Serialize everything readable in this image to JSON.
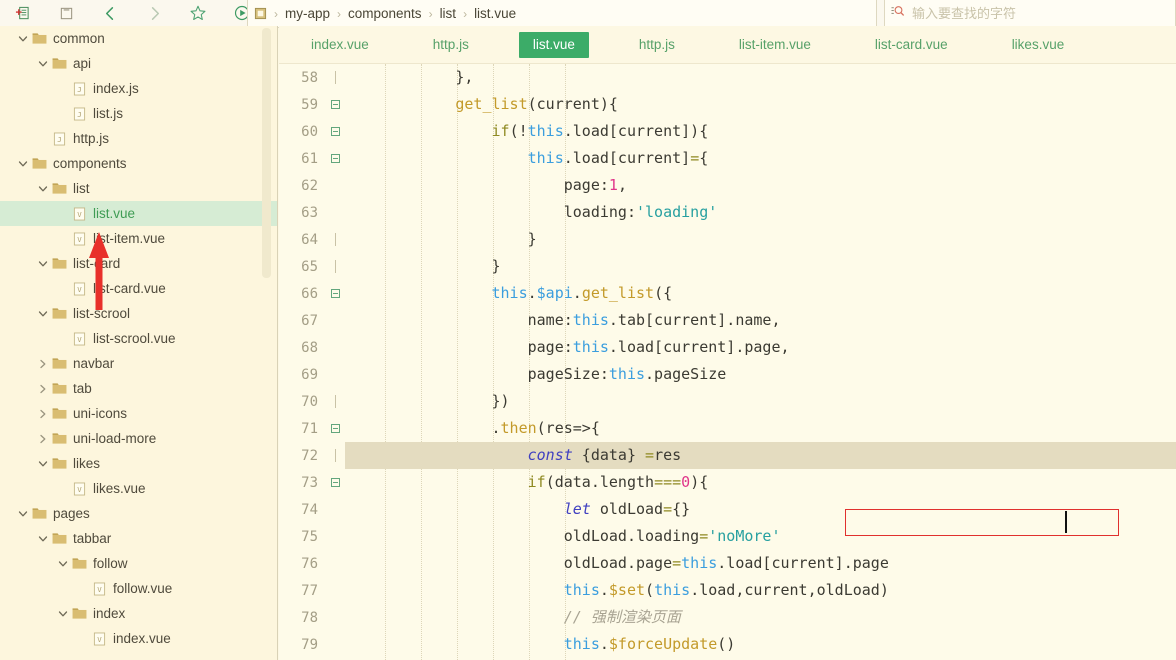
{
  "toolbar": {
    "icons": [
      {
        "name": "new-file-icon",
        "label": "New File"
      },
      {
        "name": "save-icon",
        "label": "Save"
      },
      {
        "name": "back-arrow-icon",
        "label": "Back"
      },
      {
        "name": "forward-arrow-icon",
        "label": "Forward"
      },
      {
        "name": "star-icon",
        "label": "Favorite"
      },
      {
        "name": "run-icon",
        "label": "Run"
      }
    ]
  },
  "breadcrumb": {
    "root_icon": "project-icon",
    "separator": "›",
    "items": [
      "my-app",
      "components",
      "list",
      "list.vue"
    ]
  },
  "search": {
    "icon": "search-icon",
    "placeholder": "输入要查找的字符",
    "value": ""
  },
  "sidebar": {
    "scrollbar": true,
    "tree": [
      {
        "label": "common",
        "type": "folder",
        "depth": 0,
        "state": "expanded",
        "selected": false
      },
      {
        "label": "api",
        "type": "folder",
        "depth": 1,
        "state": "expanded",
        "selected": false
      },
      {
        "label": "index.js",
        "type": "js",
        "depth": 2,
        "state": "leaf",
        "selected": false
      },
      {
        "label": "list.js",
        "type": "js",
        "depth": 2,
        "state": "leaf",
        "selected": false
      },
      {
        "label": "http.js",
        "type": "js",
        "depth": 1,
        "state": "leaf",
        "selected": false
      },
      {
        "label": "components",
        "type": "folder",
        "depth": 0,
        "state": "expanded",
        "selected": false
      },
      {
        "label": "list",
        "type": "folder",
        "depth": 1,
        "state": "expanded",
        "selected": false
      },
      {
        "label": "list.vue",
        "type": "vue",
        "depth": 2,
        "state": "leaf",
        "selected": true
      },
      {
        "label": "list-item.vue",
        "type": "vue",
        "depth": 2,
        "state": "leaf",
        "selected": false
      },
      {
        "label": "list-card",
        "type": "folder",
        "depth": 1,
        "state": "expanded",
        "selected": false
      },
      {
        "label": "list-card.vue",
        "type": "vue",
        "depth": 2,
        "state": "leaf",
        "selected": false
      },
      {
        "label": "list-scrool",
        "type": "folder",
        "depth": 1,
        "state": "expanded",
        "selected": false
      },
      {
        "label": "list-scrool.vue",
        "type": "vue",
        "depth": 2,
        "state": "leaf",
        "selected": false
      },
      {
        "label": "navbar",
        "type": "folder",
        "depth": 1,
        "state": "collapsed",
        "selected": false
      },
      {
        "label": "tab",
        "type": "folder",
        "depth": 1,
        "state": "collapsed",
        "selected": false
      },
      {
        "label": "uni-icons",
        "type": "folder",
        "depth": 1,
        "state": "collapsed",
        "selected": false
      },
      {
        "label": "uni-load-more",
        "type": "folder",
        "depth": 1,
        "state": "collapsed",
        "selected": false
      },
      {
        "label": "likes",
        "type": "folder",
        "depth": 1,
        "state": "expanded",
        "selected": false
      },
      {
        "label": "likes.vue",
        "type": "vue",
        "depth": 2,
        "state": "leaf",
        "selected": false
      },
      {
        "label": "pages",
        "type": "folder",
        "depth": 0,
        "state": "expanded",
        "selected": false
      },
      {
        "label": "tabbar",
        "type": "folder",
        "depth": 1,
        "state": "expanded",
        "selected": false
      },
      {
        "label": "follow",
        "type": "folder",
        "depth": 2,
        "state": "expanded",
        "selected": false
      },
      {
        "label": "follow.vue",
        "type": "vue",
        "depth": 3,
        "state": "leaf",
        "selected": false
      },
      {
        "label": "index",
        "type": "folder",
        "depth": 2,
        "state": "expanded",
        "selected": false
      },
      {
        "label": "index.vue",
        "type": "vue",
        "depth": 3,
        "state": "leaf",
        "selected": false
      }
    ]
  },
  "annotation": {
    "arrow_color": "#e8302a",
    "points_at": "list.vue"
  },
  "editor": {
    "tabs": [
      {
        "label": "index.vue",
        "active": false
      },
      {
        "label": "http.js",
        "active": false
      },
      {
        "label": "list.vue",
        "active": true
      },
      {
        "label": "http.js",
        "active": false
      },
      {
        "label": "list-item.vue",
        "active": false
      },
      {
        "label": "list-card.vue",
        "active": false
      },
      {
        "label": "likes.vue",
        "active": false
      }
    ],
    "active_tab_color": "#3cac68",
    "cursor_line": 72,
    "highlight_box_color": "#e0302e",
    "lines": [
      {
        "n": 58,
        "fold": "tick",
        "tokens": [
          {
            "t": "plain",
            "s": "            },"
          }
        ]
      },
      {
        "n": 59,
        "fold": "box",
        "tokens": [
          {
            "t": "plain",
            "s": "            "
          },
          {
            "t": "fn",
            "s": "get_list"
          },
          {
            "t": "plain",
            "s": "(current){"
          }
        ]
      },
      {
        "n": 60,
        "fold": "box",
        "tokens": [
          {
            "t": "plain",
            "s": "                "
          },
          {
            "t": "ctrl",
            "s": "if"
          },
          {
            "t": "plain",
            "s": "(!"
          },
          {
            "t": "this",
            "s": "this"
          },
          {
            "t": "plain",
            "s": ".load[current]){"
          }
        ]
      },
      {
        "n": 61,
        "fold": "box",
        "tokens": [
          {
            "t": "plain",
            "s": "                    "
          },
          {
            "t": "this",
            "s": "this"
          },
          {
            "t": "plain",
            "s": ".load[current]"
          },
          {
            "t": "op",
            "s": "="
          },
          {
            "t": "plain",
            "s": "{"
          }
        ]
      },
      {
        "n": 62,
        "fold": "none",
        "tokens": [
          {
            "t": "plain",
            "s": "                        page:"
          },
          {
            "t": "num",
            "s": "1"
          },
          {
            "t": "plain",
            "s": ","
          }
        ]
      },
      {
        "n": 63,
        "fold": "none",
        "tokens": [
          {
            "t": "plain",
            "s": "                        loading:"
          },
          {
            "t": "str",
            "s": "'loading'"
          }
        ]
      },
      {
        "n": 64,
        "fold": "tick",
        "tokens": [
          {
            "t": "plain",
            "s": "                    }"
          }
        ]
      },
      {
        "n": 65,
        "fold": "tick",
        "tokens": [
          {
            "t": "plain",
            "s": "                }"
          }
        ]
      },
      {
        "n": 66,
        "fold": "box",
        "tokens": [
          {
            "t": "plain",
            "s": "                "
          },
          {
            "t": "this",
            "s": "this"
          },
          {
            "t": "plain",
            "s": "."
          },
          {
            "t": "this",
            "s": "$api"
          },
          {
            "t": "plain",
            "s": "."
          },
          {
            "t": "fn",
            "s": "get_list"
          },
          {
            "t": "plain",
            "s": "({"
          }
        ]
      },
      {
        "n": 67,
        "fold": "none",
        "tokens": [
          {
            "t": "plain",
            "s": "                    name:"
          },
          {
            "t": "this",
            "s": "this"
          },
          {
            "t": "plain",
            "s": ".tab[current].name,"
          }
        ]
      },
      {
        "n": 68,
        "fold": "none",
        "tokens": [
          {
            "t": "plain",
            "s": "                    page:"
          },
          {
            "t": "this",
            "s": "this"
          },
          {
            "t": "plain",
            "s": ".load[current].page,"
          }
        ]
      },
      {
        "n": 69,
        "fold": "none",
        "tokens": [
          {
            "t": "plain",
            "s": "                    pageSize:"
          },
          {
            "t": "this",
            "s": "this"
          },
          {
            "t": "plain",
            "s": ".pageSize"
          }
        ]
      },
      {
        "n": 70,
        "fold": "tick",
        "tokens": [
          {
            "t": "plain",
            "s": "                })"
          }
        ]
      },
      {
        "n": 71,
        "fold": "box",
        "tokens": [
          {
            "t": "plain",
            "s": "                ."
          },
          {
            "t": "fn",
            "s": "then"
          },
          {
            "t": "plain",
            "s": "(res=>{"
          }
        ]
      },
      {
        "n": 72,
        "fold": "tick",
        "current": true,
        "tokens": [
          {
            "t": "plain",
            "s": "                    "
          },
          {
            "t": "key",
            "s": "const"
          },
          {
            "t": "plain",
            "s": " {data} "
          },
          {
            "t": "op",
            "s": "="
          },
          {
            "t": "plain",
            "s": "res"
          }
        ]
      },
      {
        "n": 73,
        "fold": "box",
        "tokens": [
          {
            "t": "plain",
            "s": "                    "
          },
          {
            "t": "ctrl",
            "s": "if"
          },
          {
            "t": "plain",
            "s": "(data.length"
          },
          {
            "t": "op",
            "s": "==="
          },
          {
            "t": "num",
            "s": "0"
          },
          {
            "t": "plain",
            "s": "){"
          }
        ]
      },
      {
        "n": 74,
        "fold": "none",
        "tokens": [
          {
            "t": "plain",
            "s": "                        "
          },
          {
            "t": "key",
            "s": "let"
          },
          {
            "t": "plain",
            "s": " oldLoad"
          },
          {
            "t": "op",
            "s": "="
          },
          {
            "t": "plain",
            "s": "{}"
          }
        ]
      },
      {
        "n": 75,
        "fold": "none",
        "tokens": [
          {
            "t": "plain",
            "s": "                        oldLoad.loading"
          },
          {
            "t": "op",
            "s": "="
          },
          {
            "t": "str",
            "s": "'noMore'"
          }
        ]
      },
      {
        "n": 76,
        "fold": "none",
        "tokens": [
          {
            "t": "plain",
            "s": "                        oldLoad.page"
          },
          {
            "t": "op",
            "s": "="
          },
          {
            "t": "this",
            "s": "this"
          },
          {
            "t": "plain",
            "s": ".load[current].page"
          }
        ]
      },
      {
        "n": 77,
        "fold": "none",
        "tokens": [
          {
            "t": "plain",
            "s": "                        "
          },
          {
            "t": "this",
            "s": "this"
          },
          {
            "t": "plain",
            "s": "."
          },
          {
            "t": "fn",
            "s": "$set"
          },
          {
            "t": "plain",
            "s": "("
          },
          {
            "t": "this",
            "s": "this"
          },
          {
            "t": "plain",
            "s": ".load,current,oldLoad)"
          }
        ]
      },
      {
        "n": 78,
        "fold": "none",
        "tokens": [
          {
            "t": "plain",
            "s": "                        "
          },
          {
            "t": "cmt",
            "s": "// 强制渲染页面"
          }
        ]
      },
      {
        "n": 79,
        "fold": "none",
        "tokens": [
          {
            "t": "plain",
            "s": "                        "
          },
          {
            "t": "this",
            "s": "this"
          },
          {
            "t": "plain",
            "s": "."
          },
          {
            "t": "fn",
            "s": "$forceUpdate"
          },
          {
            "t": "plain",
            "s": "()"
          }
        ]
      }
    ]
  }
}
